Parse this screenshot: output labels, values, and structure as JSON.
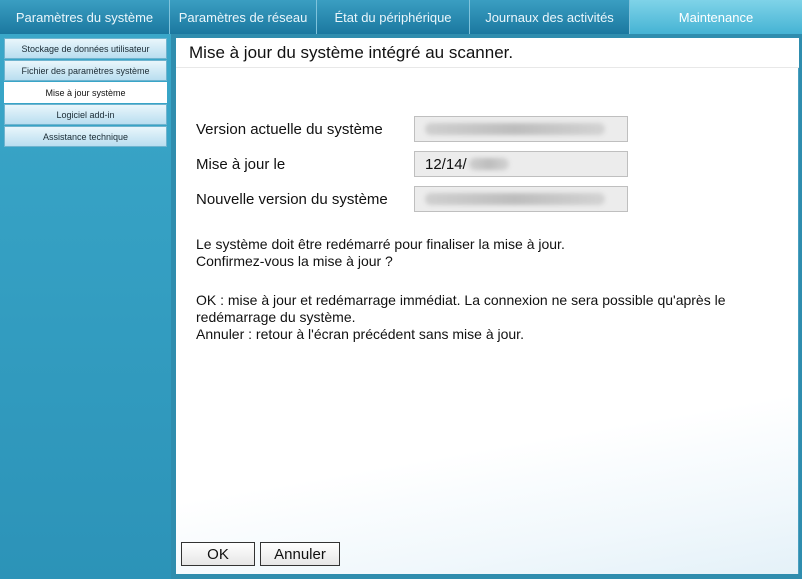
{
  "tabs": [
    {
      "label": "Paramètres du système",
      "active": false
    },
    {
      "label": "Paramètres de réseau",
      "active": false
    },
    {
      "label": "État du périphérique",
      "active": false
    },
    {
      "label": "Journaux des activités",
      "active": false
    },
    {
      "label": "Maintenance",
      "active": true
    }
  ],
  "sidebar": {
    "items": [
      {
        "label": "Stockage de données utilisateur",
        "active": false
      },
      {
        "label": "Fichier des paramètres système",
        "active": false
      },
      {
        "label": "Mise à jour système",
        "active": true
      },
      {
        "label": "Logiciel add-in",
        "active": false
      },
      {
        "label": "Assistance technique",
        "active": false
      }
    ]
  },
  "main": {
    "title": "Mise à jour du système intégré au scanner.",
    "fields": {
      "current_version_label": "Version actuelle du système",
      "update_date_label": "Mise à jour le",
      "update_date_value": "12/14/",
      "new_version_label": "Nouvelle version du système"
    },
    "messages": {
      "restart_line1": "Le système doit être redémarré pour finaliser la mise à jour.",
      "restart_line2": "Confirmez-vous la mise à jour ?",
      "ok_line1": "OK : mise à jour et redémarrage immédiat. La connexion ne sera possible qu'après le",
      "ok_line2": "redémarrage du système.",
      "cancel_line": "Annuler : retour à l'écran précédent sans mise à jour."
    },
    "buttons": {
      "ok": "OK",
      "cancel": "Annuler"
    }
  },
  "colors": {
    "tab_bar": "#1d7fa4",
    "active_tab": "#45b3d4",
    "sidebar": "#2f8dae"
  }
}
